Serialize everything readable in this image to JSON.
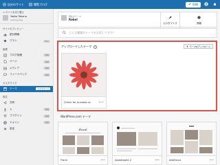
{
  "topbar": {
    "my_site": "自分のサイト",
    "reader": "閲覧ブログ",
    "write": "投稿"
  },
  "sidebar": {
    "back_label": "< サイトを切り替え",
    "site_name": "Yaeko Takano",
    "site_url": "zeadog.blog",
    "preview_label": "サイトのプレビュー",
    "stats": "統計情報",
    "plan": "プラン",
    "plan_badge": "Free",
    "section_manage": "管理",
    "items": [
      {
        "label": "ブログ投稿",
        "badge": "追加"
      },
      {
        "label": "ページ",
        "badge": "追加"
      },
      {
        "label": "メディア",
        "badge": "追加"
      },
      {
        "label": "フィードバック",
        "badge": "追加"
      }
    ],
    "section_design": "カスタマイズ",
    "themes": "テーマ",
    "themes_badge": "カスタマイズ",
    "section_tools": "設定",
    "lower_items": [
      {
        "label": "共有",
        "badge": ""
      },
      {
        "label": "人",
        "badge": "追加"
      },
      {
        "label": "プラグイン",
        "badge": "追加"
      },
      {
        "label": "ドメイン",
        "badge": "追加"
      },
      {
        "label": "設定",
        "badge": ""
      }
    ]
  },
  "header": {
    "site_label": "現在のテーマ",
    "site_name": "Rebel",
    "customize": "カスタマイズ",
    "info": "情報"
  },
  "search": {
    "placeholder": "どんな種類のテーマをお探しですか？"
  },
  "uploaded": {
    "title": "アップロードしたテーマ",
    "upload_button": "テーマをアップロード",
    "theme_name": "Chunk for ja.nasko.co",
    "dots": "•••"
  },
  "wp_themes": {
    "title": "WordPress.com テーマ",
    "items": [
      {
        "name": "Floral",
        "shot_title": "Floral",
        "dots": "•••"
      },
      {
        "name": "Apostrophe 2",
        "shot_title": "",
        "dots": "•••"
      },
      {
        "name": "AltoFocus",
        "shot_title": "",
        "dots": "•••"
      }
    ]
  },
  "colors": {
    "accent": "#1e6fb0",
    "highlight": "#e0504a"
  }
}
